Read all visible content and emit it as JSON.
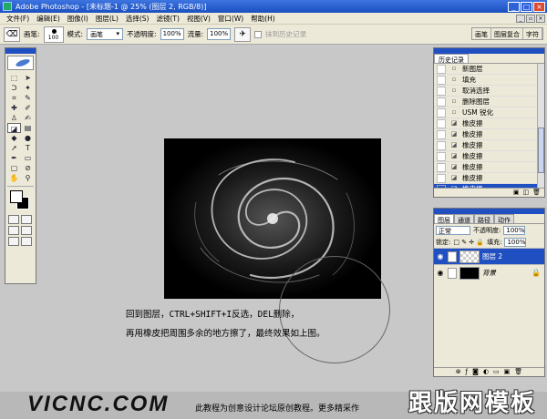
{
  "window": {
    "title": "Adobe Photoshop - [未标题-1 @ 25% (图层 2, RGB/8)]",
    "controls": [
      "_",
      "□",
      "×"
    ]
  },
  "menubar": {
    "items": [
      "文件(F)",
      "编辑(E)",
      "图像(I)",
      "图层(L)",
      "选择(S)",
      "滤镜(T)",
      "视图(V)",
      "窗口(W)",
      "帮助(H)"
    ]
  },
  "options": {
    "brush_label": "画笔:",
    "brush_size": "100",
    "mode_label": "模式:",
    "mode_value": "画笔",
    "opacity_label": "不透明度:",
    "opacity_value": "100%",
    "flow_label": "流量:",
    "flow_value": "100%",
    "erase_history_label": "抹到历史记录",
    "palette_tabs": [
      "画笔",
      "图层复合",
      "字符"
    ]
  },
  "history": {
    "tab": "历史记录",
    "items": [
      {
        "label": "新图层",
        "active": false
      },
      {
        "label": "填充",
        "active": false
      },
      {
        "label": "取消选择",
        "active": false
      },
      {
        "label": "删除图层",
        "active": false
      },
      {
        "label": "USM 锐化",
        "active": false
      },
      {
        "label": "橡皮擦",
        "active": false
      },
      {
        "label": "橡皮擦",
        "active": false
      },
      {
        "label": "橡皮擦",
        "active": false
      },
      {
        "label": "橡皮擦",
        "active": false
      },
      {
        "label": "橡皮擦",
        "active": false
      },
      {
        "label": "橡皮擦",
        "active": false
      },
      {
        "label": "橡皮擦",
        "active": true
      }
    ]
  },
  "layers": {
    "tabs": [
      "图层",
      "通道",
      "路径",
      "动作"
    ],
    "blend_mode": "正常",
    "opacity_label": "不透明度:",
    "opacity_value": "100%",
    "lock_label": "锁定:",
    "fill_label": "填充:",
    "fill_value": "100%",
    "items": [
      {
        "name": "图层 2",
        "active": true
      },
      {
        "name": "背景",
        "active": false
      }
    ]
  },
  "instructions": {
    "line1": "回到图层，CTRL+SHIFT+I反选，DEL删除，",
    "line2": "再用橡皮把周围多余的地方擦了，最终效果如上图。"
  },
  "watermark": {
    "logo": "VICNC.COM",
    "text": "此教程为创意设计论坛原创教程。更多精采作",
    "brand": "跟版网模板"
  }
}
